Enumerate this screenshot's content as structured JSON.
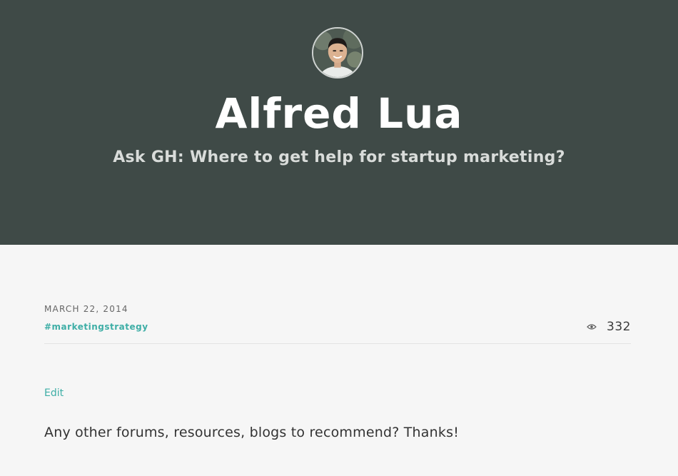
{
  "hero": {
    "author_name": "Alfred Lua",
    "post_title": "Ask GH: Where to get help for startup marketing?",
    "avatar_icon": "avatar-photo"
  },
  "post": {
    "date": "MARCH 22, 2014",
    "tag": "#marketingstrategy",
    "view_icon": "eye-icon",
    "view_count": "332",
    "edit_label": "Edit",
    "body": "Any other forums, resources, blogs to recommend? Thanks!"
  },
  "colors": {
    "hero_background": "#3f4a47",
    "accent": "#3eaea6",
    "page_background": "#f6f6f6"
  }
}
